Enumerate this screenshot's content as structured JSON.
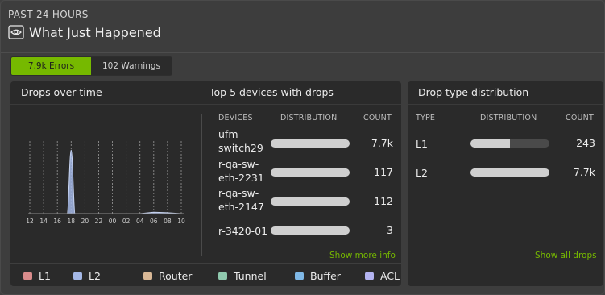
{
  "header": {
    "subtitle": "PAST 24 HOURS",
    "title": "What Just Happened",
    "icon": "eye-icon"
  },
  "tabs": [
    {
      "label": "7.9k Errors",
      "active": true
    },
    {
      "label": "102 Warnings",
      "active": false
    }
  ],
  "drops_over_time": {
    "title": "Drops over time",
    "x_ticks": [
      "12",
      "14",
      "16",
      "18",
      "20",
      "22",
      "00",
      "02",
      "04",
      "06",
      "08",
      "10"
    ]
  },
  "top_devices": {
    "title": "Top 5 devices with drops",
    "columns": [
      "DEVICES",
      "DISTRIBUTION",
      "COUNT"
    ],
    "rows": [
      {
        "device": "ufm-switch29",
        "count": "7.7k",
        "fill": 0.0
      },
      {
        "device": "r-qa-sw-eth-2231",
        "count": "117",
        "fill": 0.0
      },
      {
        "device": "r-qa-sw-eth-2147",
        "count": "112",
        "fill": 0.0
      },
      {
        "device": "r-3420-01",
        "count": "3",
        "fill": 0.0
      }
    ],
    "link": "Show more info"
  },
  "drop_types": {
    "title": "Drop type distribution",
    "columns": [
      "TYPE",
      "DISTRIBUTION",
      "COUNT"
    ],
    "rows": [
      {
        "type": "L1",
        "count": "243",
        "fill": 0.5
      },
      {
        "type": "L2",
        "count": "7.7k",
        "fill": 0.0
      }
    ],
    "link": "Show all drops"
  },
  "legend": [
    {
      "label": "L1",
      "color": "#d98b8b"
    },
    {
      "label": "L2",
      "color": "#a4b8e6"
    },
    {
      "label": "Router",
      "color": "#d9b896"
    },
    {
      "label": "Tunnel",
      "color": "#8fc9ae"
    },
    {
      "label": "Buffer",
      "color": "#7fb8e6"
    },
    {
      "label": "ACL",
      "color": "#b3b3f0"
    }
  ],
  "colors": {
    "accent": "#76b900",
    "background": "#3d3d3d",
    "card": "#2a2a2a"
  },
  "chart_data": {
    "type": "area",
    "x": [
      "12",
      "14",
      "16",
      "18",
      "20",
      "22",
      "00",
      "02",
      "04",
      "06",
      "08",
      "10"
    ],
    "series": [
      {
        "values": [
          0,
          0,
          0,
          7000,
          0,
          0,
          0,
          0,
          0,
          150,
          100,
          0
        ]
      }
    ],
    "ylim": [
      0,
      8000
    ],
    "grid": true
  }
}
